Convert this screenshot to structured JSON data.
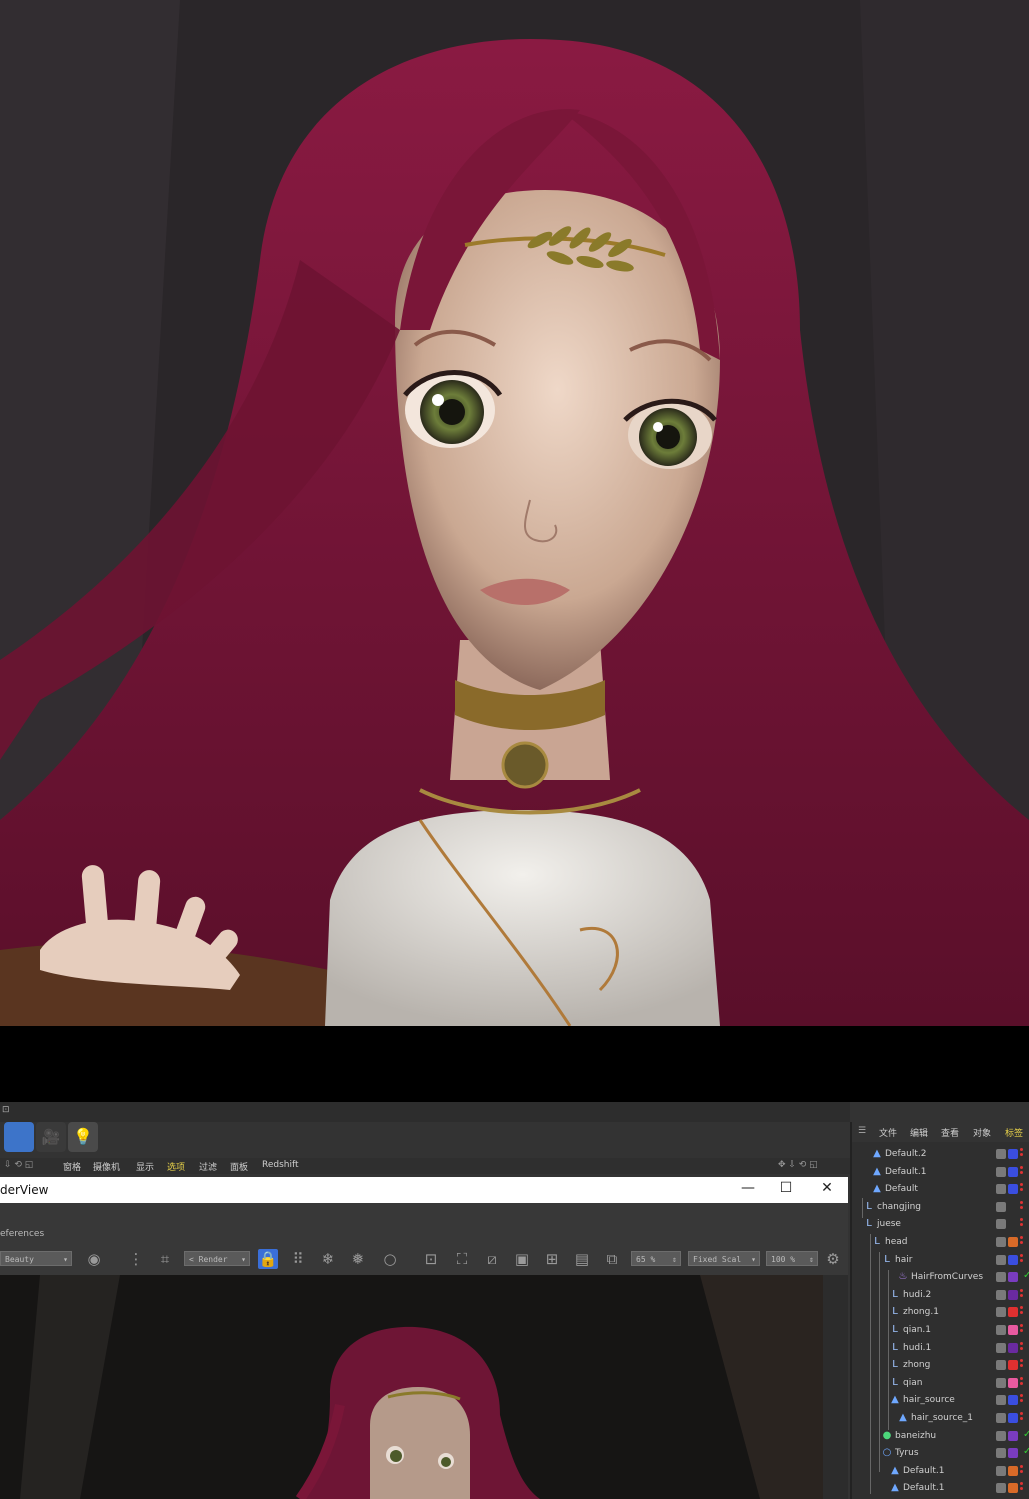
{
  "render_view": {
    "title": "derView",
    "window_buttons": [
      "—",
      "☐",
      "✕"
    ],
    "preferences_label": "eferences",
    "channel_select": "Beauty",
    "camera_select": "< Render",
    "zoom_value": "65 %",
    "scale_select": "Fixed Scal",
    "percent_value": "100 %"
  },
  "menubar": {
    "items": [
      "窗格",
      "摄像机",
      "显示",
      "选项",
      "过滤",
      "面板",
      "Redshift"
    ]
  },
  "object_manager": {
    "menu": [
      "文件",
      "编辑",
      "查看",
      "对象",
      "标签"
    ],
    "objects": [
      {
        "name": "Default.2",
        "icon": "light-icon",
        "tag_color": "#3a4ee0",
        "check": false
      },
      {
        "name": "Default.1",
        "icon": "light-icon",
        "tag_color": "#3a4ee0",
        "check": false
      },
      {
        "name": "Default",
        "icon": "light-icon",
        "tag_color": "#3a4ee0",
        "check": false
      },
      {
        "name": "changjing",
        "icon": "null-icon",
        "tag_color": "",
        "check": false
      },
      {
        "name": "juese",
        "icon": "null-icon",
        "tag_color": "",
        "check": false
      },
      {
        "name": "head",
        "icon": "null-icon",
        "tag_color": "#d86a28",
        "check": false
      },
      {
        "name": "hair",
        "icon": "null-icon",
        "tag_color": "#3a4ee0",
        "check": false
      },
      {
        "name": "HairFromCurves",
        "icon": "hair-icon",
        "tag_color": "#7a3cc0",
        "check": true
      },
      {
        "name": "hudi.2",
        "icon": "null-icon",
        "tag_color": "#6a2aa0",
        "check": false
      },
      {
        "name": "zhong.1",
        "icon": "null-icon",
        "tag_color": "#e03030",
        "check": false
      },
      {
        "name": "qian.1",
        "icon": "null-icon",
        "tag_color": "#e85aa0",
        "check": false
      },
      {
        "name": "hudi.1",
        "icon": "null-icon",
        "tag_color": "#6a2aa0",
        "check": false
      },
      {
        "name": "zhong",
        "icon": "null-icon",
        "tag_color": "#e03030",
        "check": false
      },
      {
        "name": "qian",
        "icon": "null-icon",
        "tag_color": "#e85aa0",
        "check": false
      },
      {
        "name": "hair_source",
        "icon": "light-icon",
        "tag_color": "#3a4ee0",
        "check": false
      },
      {
        "name": "hair_source_1",
        "icon": "light-icon",
        "tag_color": "#3a4ee0",
        "check": false
      },
      {
        "name": "baneizhu",
        "icon": "sphere-icon",
        "tag_color": "#7a3cc0",
        "check": true
      },
      {
        "name": "Tyrus",
        "icon": "torus-icon",
        "tag_color": "#7a3cc0",
        "check": true
      },
      {
        "name": "Default.1",
        "icon": "light-icon",
        "tag_color": "#d86a28",
        "check": false
      },
      {
        "name": "Default.1",
        "icon": "light-icon",
        "tag_color": "#d86a28",
        "check": false
      }
    ]
  },
  "colors": {
    "hair": "#7a1638",
    "accent_blue": "#3a6fd8",
    "panel_bg": "#333333"
  }
}
